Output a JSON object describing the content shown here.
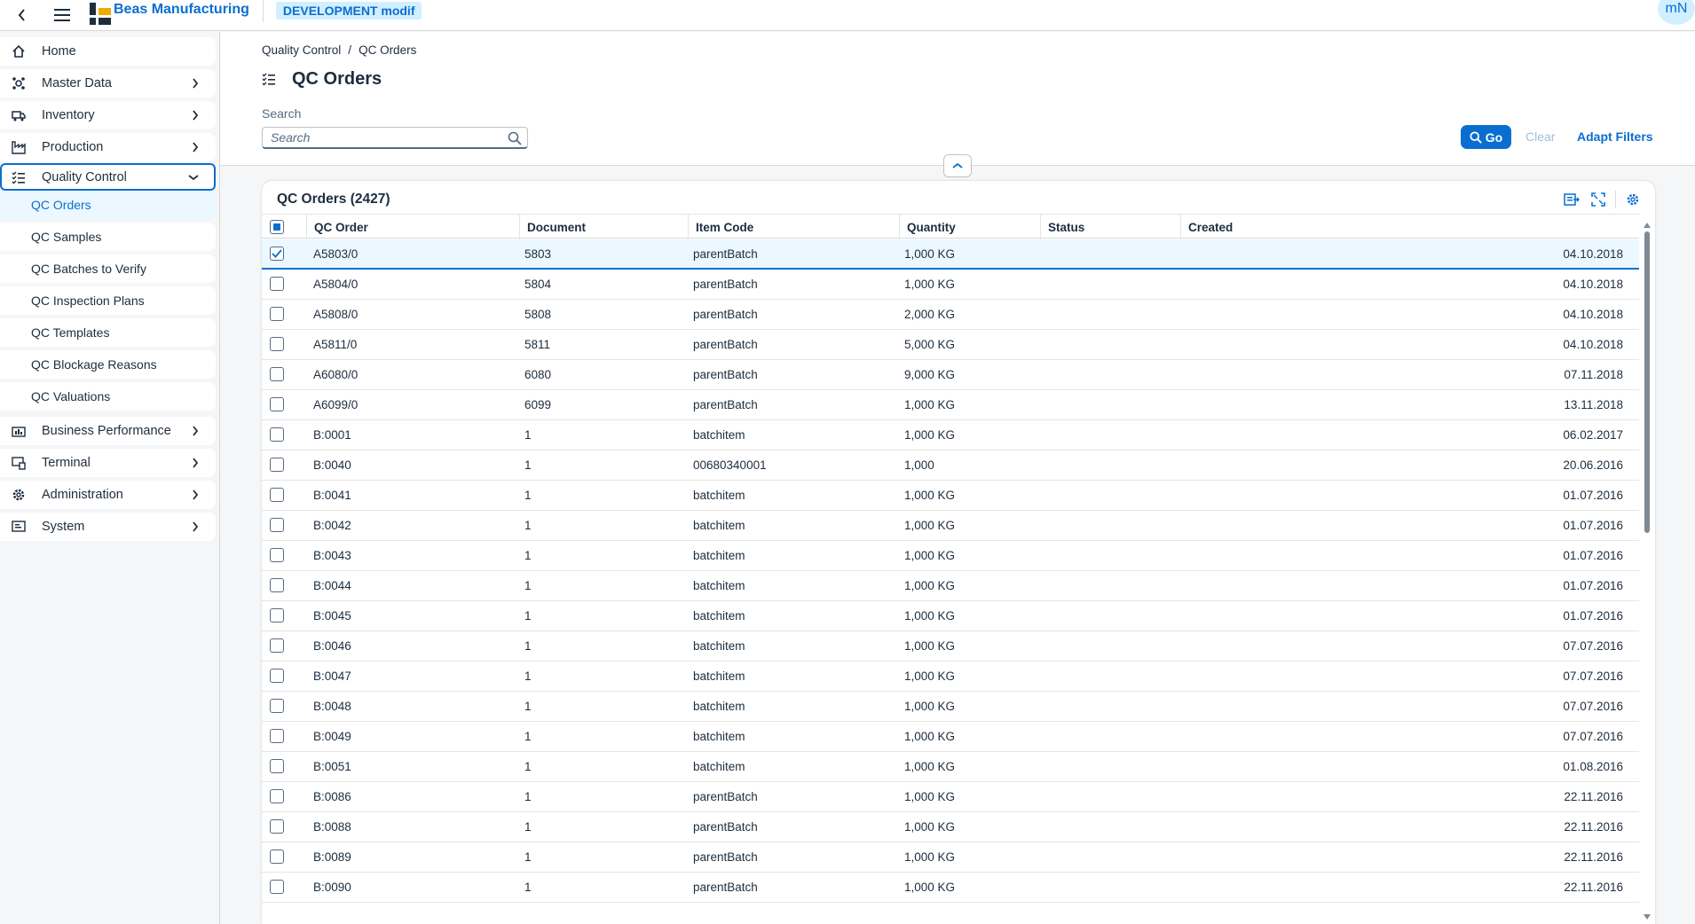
{
  "shell": {
    "brand": "Beas Manufacturing",
    "environment": "DEVELOPMENT modif",
    "avatar_initials": "mN",
    "accent_color": "#0a6ed1"
  },
  "sidebar": {
    "items": [
      {
        "label": "Home",
        "icon": "home-icon",
        "has_children": false
      },
      {
        "label": "Master Data",
        "icon": "cube-icon",
        "has_children": true
      },
      {
        "label": "Inventory",
        "icon": "truck-icon",
        "has_children": true
      },
      {
        "label": "Production",
        "icon": "factory-icon",
        "has_children": true
      },
      {
        "label": "Quality Control",
        "icon": "checklist-icon",
        "has_children": true,
        "expanded": true
      },
      {
        "label": "Business Performance",
        "icon": "chart-icon",
        "has_children": true
      },
      {
        "label": "Terminal",
        "icon": "terminal-icon",
        "has_children": true
      },
      {
        "label": "Administration",
        "icon": "gear-icon",
        "has_children": true
      },
      {
        "label": "System",
        "icon": "system-icon",
        "has_children": true
      }
    ],
    "qc_sub_items": [
      {
        "label": "QC Orders",
        "active": true
      },
      {
        "label": "QC Samples"
      },
      {
        "label": "QC Batches to Verify"
      },
      {
        "label": "QC Inspection Plans"
      },
      {
        "label": "QC Templates"
      },
      {
        "label": "QC Blockage Reasons"
      },
      {
        "label": "QC Valuations"
      }
    ]
  },
  "breadcrumb": [
    "Quality Control",
    "QC Orders"
  ],
  "breadcrumb_sep": "/",
  "page": {
    "title": "QC Orders",
    "search_label": "Search",
    "search_placeholder": "Search",
    "go_label": "Go",
    "clear_label": "Clear",
    "adapt_filters_label": "Adapt Filters"
  },
  "table": {
    "title": "QC Orders (2427)",
    "columns": [
      "QC Order",
      "Document",
      "Item Code",
      "Quantity",
      "Status",
      "Created"
    ],
    "rows": [
      {
        "qc_order": "A5803/0",
        "document": "5803",
        "item_code": "parentBatch",
        "quantity": "1,000 KG",
        "status": "",
        "created": "04.10.2018",
        "selected": true
      },
      {
        "qc_order": "A5804/0",
        "document": "5804",
        "item_code": "parentBatch",
        "quantity": "1,000 KG",
        "status": "",
        "created": "04.10.2018"
      },
      {
        "qc_order": "A5808/0",
        "document": "5808",
        "item_code": "parentBatch",
        "quantity": "2,000 KG",
        "status": "",
        "created": "04.10.2018"
      },
      {
        "qc_order": "A5811/0",
        "document": "5811",
        "item_code": "parentBatch",
        "quantity": "5,000 KG",
        "status": "",
        "created": "04.10.2018"
      },
      {
        "qc_order": "A6080/0",
        "document": "6080",
        "item_code": "parentBatch",
        "quantity": "9,000 KG",
        "status": "",
        "created": "07.11.2018"
      },
      {
        "qc_order": "A6099/0",
        "document": "6099",
        "item_code": "parentBatch",
        "quantity": "1,000 KG",
        "status": "",
        "created": "13.11.2018"
      },
      {
        "qc_order": "B:0001",
        "document": "1",
        "item_code": "batchitem",
        "quantity": "1,000 KG",
        "status": "",
        "created": "06.02.2017"
      },
      {
        "qc_order": "B:0040",
        "document": "1",
        "item_code": "00680340001",
        "quantity": "1,000",
        "status": "",
        "created": "20.06.2016"
      },
      {
        "qc_order": "B:0041",
        "document": "1",
        "item_code": "batchitem",
        "quantity": "1,000 KG",
        "status": "",
        "created": "01.07.2016"
      },
      {
        "qc_order": "B:0042",
        "document": "1",
        "item_code": "batchitem",
        "quantity": "1,000 KG",
        "status": "",
        "created": "01.07.2016"
      },
      {
        "qc_order": "B:0043",
        "document": "1",
        "item_code": "batchitem",
        "quantity": "1,000 KG",
        "status": "",
        "created": "01.07.2016"
      },
      {
        "qc_order": "B:0044",
        "document": "1",
        "item_code": "batchitem",
        "quantity": "1,000 KG",
        "status": "",
        "created": "01.07.2016"
      },
      {
        "qc_order": "B:0045",
        "document": "1",
        "item_code": "batchitem",
        "quantity": "1,000 KG",
        "status": "",
        "created": "01.07.2016"
      },
      {
        "qc_order": "B:0046",
        "document": "1",
        "item_code": "batchitem",
        "quantity": "1,000 KG",
        "status": "",
        "created": "07.07.2016"
      },
      {
        "qc_order": "B:0047",
        "document": "1",
        "item_code": "batchitem",
        "quantity": "1,000 KG",
        "status": "",
        "created": "07.07.2016"
      },
      {
        "qc_order": "B:0048",
        "document": "1",
        "item_code": "batchitem",
        "quantity": "1,000 KG",
        "status": "",
        "created": "07.07.2016"
      },
      {
        "qc_order": "B:0049",
        "document": "1",
        "item_code": "batchitem",
        "quantity": "1,000 KG",
        "status": "",
        "created": "07.07.2016"
      },
      {
        "qc_order": "B:0051",
        "document": "1",
        "item_code": "batchitem",
        "quantity": "1,000 KG",
        "status": "",
        "created": "01.08.2016"
      },
      {
        "qc_order": "B:0086",
        "document": "1",
        "item_code": "parentBatch",
        "quantity": "1,000 KG",
        "status": "",
        "created": "22.11.2016"
      },
      {
        "qc_order": "B:0088",
        "document": "1",
        "item_code": "parentBatch",
        "quantity": "1,000 KG",
        "status": "",
        "created": "22.11.2016"
      },
      {
        "qc_order": "B:0089",
        "document": "1",
        "item_code": "parentBatch",
        "quantity": "1,000 KG",
        "status": "",
        "created": "22.11.2016"
      },
      {
        "qc_order": "B:0090",
        "document": "1",
        "item_code": "parentBatch",
        "quantity": "1,000 KG",
        "status": "",
        "created": "22.11.2016"
      }
    ]
  }
}
